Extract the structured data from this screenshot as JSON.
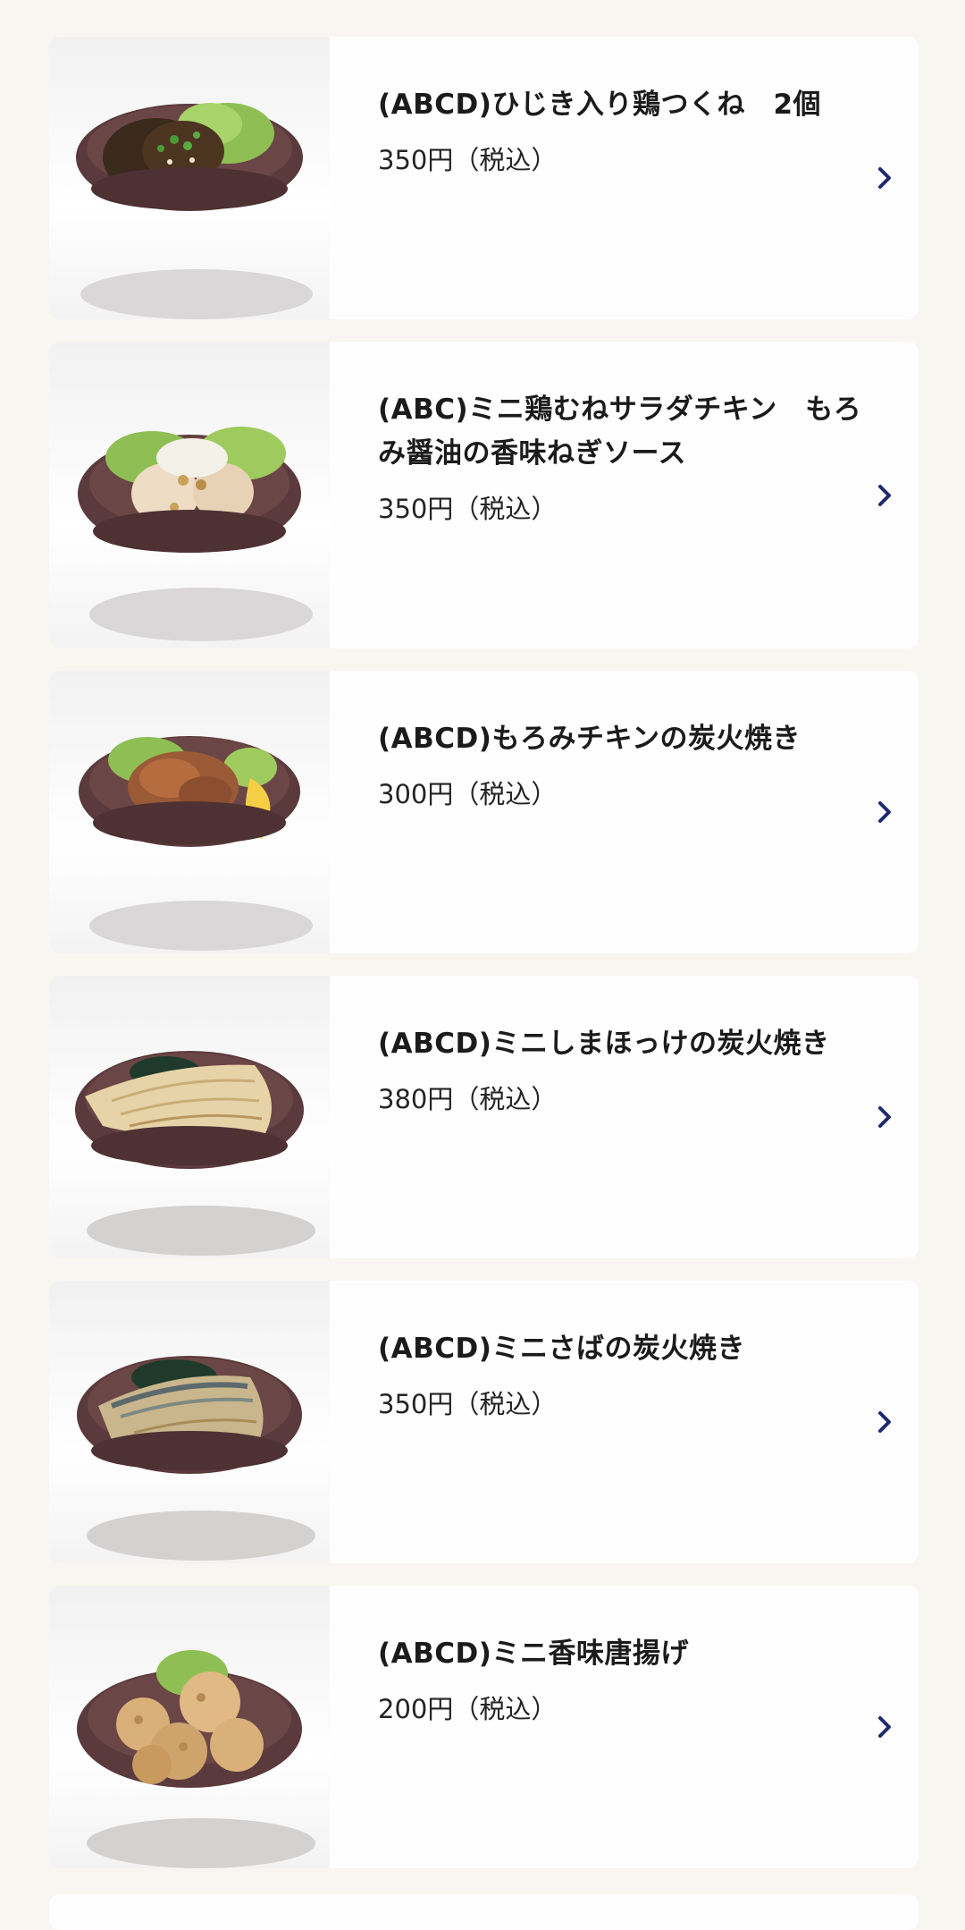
{
  "colors": {
    "page_background": "#f7f6f1",
    "card_background": "#fefefe",
    "chevron": "#1f2a6b",
    "bowl": "#5a3a3c"
  },
  "menu": {
    "items": [
      {
        "name": "(ABCD)ひじき入り鶏つくね　2個",
        "price": "350円（税込）",
        "image_icon": "tsukune-bowl-icon",
        "chevron_icon": "chevron-right-icon"
      },
      {
        "name": "(ABC)ミニ鶏むねサラダチキン　もろみ醤油の香味ねぎソース",
        "price": "350円（税込）",
        "image_icon": "salad-chicken-bowl-icon",
        "chevron_icon": "chevron-right-icon"
      },
      {
        "name": "(ABCD)もろみチキンの炭火焼き",
        "price": "300円（税込）",
        "image_icon": "grilled-chicken-bowl-icon",
        "chevron_icon": "chevron-right-icon"
      },
      {
        "name": "(ABCD)ミニしまほっけの炭火焼き",
        "price": "380円（税込）",
        "image_icon": "grilled-hokke-bowl-icon",
        "chevron_icon": "chevron-right-icon"
      },
      {
        "name": "(ABCD)ミニさばの炭火焼き",
        "price": "350円（税込）",
        "image_icon": "grilled-mackerel-bowl-icon",
        "chevron_icon": "chevron-right-icon"
      },
      {
        "name": "(ABCD)ミニ香味唐揚げ",
        "price": "200円（税込）",
        "image_icon": "karaage-bowl-icon",
        "chevron_icon": "chevron-right-icon"
      }
    ]
  }
}
